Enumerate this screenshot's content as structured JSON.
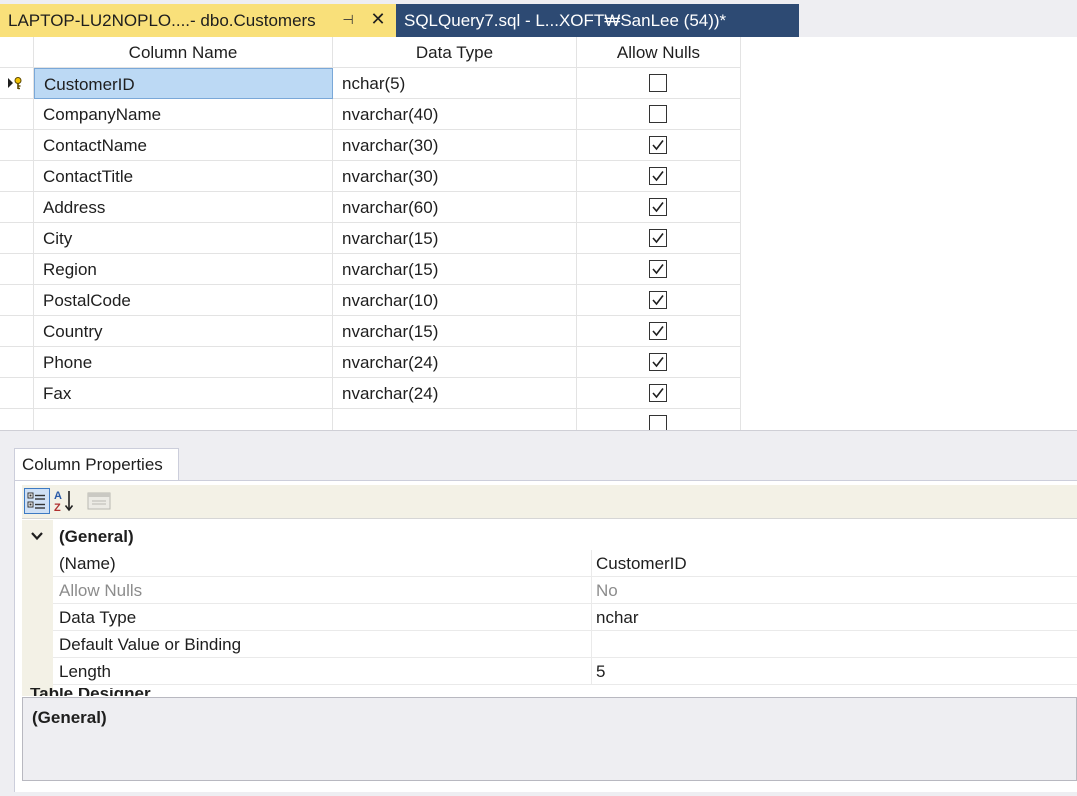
{
  "tabs": {
    "active": {
      "title": "LAPTOP-LU2NOPLO....- dbo.Customers",
      "pin_glyph": "⊣",
      "close_glyph": "✕"
    },
    "inactive": {
      "title": "SQLQuery7.sql - L...XOFT₩SanLee (54))*"
    }
  },
  "grid": {
    "headers": {
      "column_name": "Column Name",
      "data_type": "Data Type",
      "allow_nulls": "Allow Nulls"
    },
    "rows": [
      {
        "name": "CustomerID",
        "type": "nchar(5)",
        "allow_nulls": false,
        "primary_key": true,
        "selected": true
      },
      {
        "name": "CompanyName",
        "type": "nvarchar(40)",
        "allow_nulls": false
      },
      {
        "name": "ContactName",
        "type": "nvarchar(30)",
        "allow_nulls": true
      },
      {
        "name": "ContactTitle",
        "type": "nvarchar(30)",
        "allow_nulls": true
      },
      {
        "name": "Address",
        "type": "nvarchar(60)",
        "allow_nulls": true
      },
      {
        "name": "City",
        "type": "nvarchar(15)",
        "allow_nulls": true
      },
      {
        "name": "Region",
        "type": "nvarchar(15)",
        "allow_nulls": true
      },
      {
        "name": "PostalCode",
        "type": "nvarchar(10)",
        "allow_nulls": true
      },
      {
        "name": "Country",
        "type": "nvarchar(15)",
        "allow_nulls": true
      },
      {
        "name": "Phone",
        "type": "nvarchar(24)",
        "allow_nulls": true
      },
      {
        "name": "Fax",
        "type": "nvarchar(24)",
        "allow_nulls": true
      },
      {
        "name": "",
        "type": "",
        "allow_nulls": false
      }
    ]
  },
  "column_properties": {
    "tab_label": "Column Properties",
    "toolbar": {
      "categorized_icon": "categorized-icon",
      "alphabetical_icon": "sort-az-icon",
      "property_pages_icon": "property-pages-icon"
    },
    "category": "(General)",
    "properties": [
      {
        "name": "(Name)",
        "value": "CustomerID",
        "disabled": false
      },
      {
        "name": "Allow Nulls",
        "value": "No",
        "disabled": true
      },
      {
        "name": "Data Type",
        "value": "nchar",
        "disabled": false
      },
      {
        "name": "Default Value or Binding",
        "value": "",
        "disabled": false
      },
      {
        "name": "Length",
        "value": "5",
        "disabled": false
      }
    ],
    "next_category_partial": "Table Designer",
    "description_title": "(General)"
  },
  "colors": {
    "active_tab": "#f9e07a",
    "inactive_tab": "#2d4a73",
    "selection": "#bcd9f4",
    "background": "#eeeef2"
  }
}
